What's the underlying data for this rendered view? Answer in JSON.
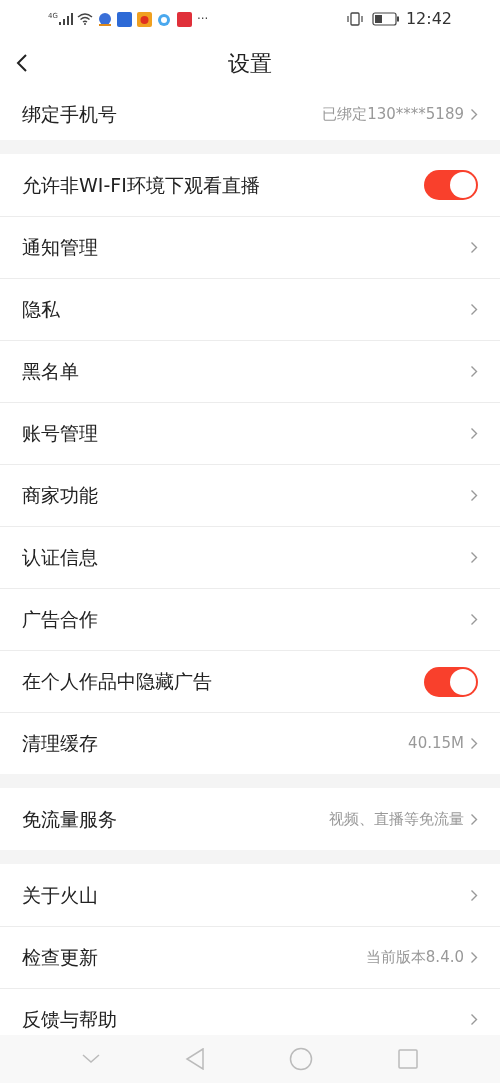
{
  "status_bar": {
    "network": "4G",
    "more": "···",
    "time": "12:42"
  },
  "header": {
    "title": "设置"
  },
  "sections": [
    [
      {
        "kind": "link",
        "label": "绑定手机号",
        "value": "已绑定130****5189"
      }
    ],
    [
      {
        "kind": "toggle",
        "label": "允许非WI-FI环境下观看直播",
        "on": true
      },
      {
        "kind": "link",
        "label": "通知管理"
      },
      {
        "kind": "link",
        "label": "隐私"
      },
      {
        "kind": "link",
        "label": "黑名单"
      },
      {
        "kind": "link",
        "label": "账号管理"
      },
      {
        "kind": "link",
        "label": "商家功能"
      },
      {
        "kind": "link",
        "label": "认证信息"
      },
      {
        "kind": "link",
        "label": "广告合作"
      },
      {
        "kind": "toggle",
        "label": "在个人作品中隐藏广告",
        "on": true
      },
      {
        "kind": "link",
        "label": "清理缓存",
        "value": "40.15M"
      }
    ],
    [
      {
        "kind": "link",
        "label": "免流量服务",
        "value": "视频、直播等免流量"
      }
    ],
    [
      {
        "kind": "link",
        "label": "关于火山"
      },
      {
        "kind": "link",
        "label": "检查更新",
        "value": "当前版本8.4.0"
      },
      {
        "kind": "link",
        "label": "反馈与帮助"
      }
    ]
  ]
}
